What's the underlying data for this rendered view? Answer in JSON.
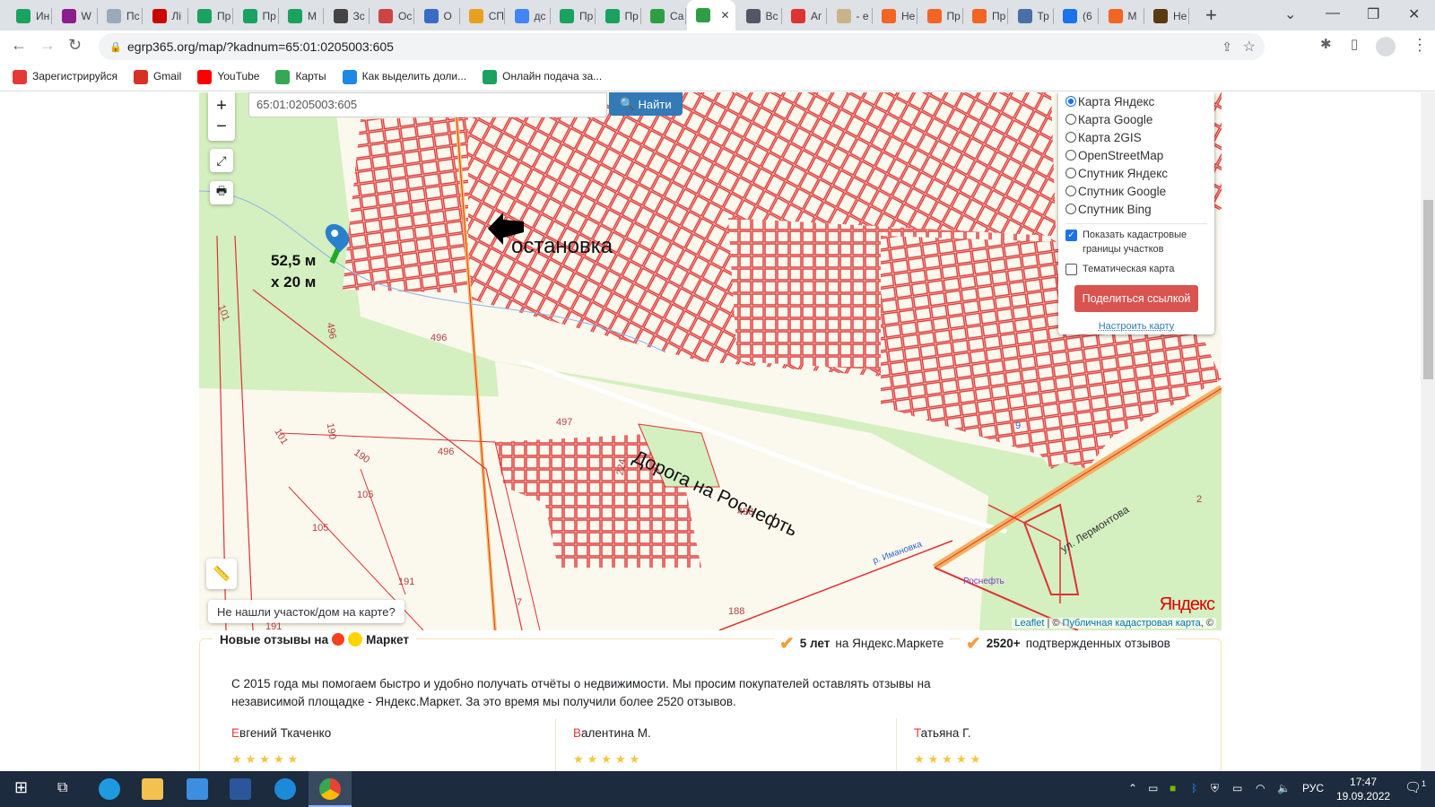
{
  "browser": {
    "tabs": [
      {
        "label": "Ин",
        "color": "#1aa260"
      },
      {
        "label": "W",
        "color": "#8b1e8b"
      },
      {
        "label": "Пс",
        "color": "#9ab"
      },
      {
        "label": "Лі",
        "color": "#c00"
      },
      {
        "label": "Пр",
        "color": "#1aa260"
      },
      {
        "label": "Пр",
        "color": "#1aa260"
      },
      {
        "label": "М",
        "color": "#1aa260"
      },
      {
        "label": "Зс",
        "color": "#444"
      },
      {
        "label": "Ос",
        "color": "#c44"
      },
      {
        "label": "О",
        "color": "#3b6cc4"
      },
      {
        "label": "СП",
        "color": "#e8a020"
      },
      {
        "label": "дс",
        "color": "#4285f4"
      },
      {
        "label": "Пр",
        "color": "#1aa260"
      },
      {
        "label": "Пр",
        "color": "#1aa260"
      },
      {
        "label": "Са",
        "color": "#2e9e44"
      },
      {
        "label": "",
        "color": "#2e9e44",
        "active": true
      },
      {
        "label": "Вс",
        "color": "#556"
      },
      {
        "label": "Аг",
        "color": "#d33"
      },
      {
        "label": "- е",
        "color": "#c9b38a"
      },
      {
        "label": "Не",
        "color": "#f26522"
      },
      {
        "label": "Пр",
        "color": "#f26522"
      },
      {
        "label": "Пр",
        "color": "#f26522"
      },
      {
        "label": "Тр",
        "color": "#4a6fa5"
      },
      {
        "label": "(6",
        "color": "#1a73e8"
      },
      {
        "label": "М",
        "color": "#f26522"
      },
      {
        "label": "Не",
        "color": "#5a3a10"
      }
    ],
    "url": "egrp365.org/map/?kadnum=65:01:0205003:605",
    "bookmarks": [
      {
        "label": "Зарегистрируйся",
        "color": "#e53935"
      },
      {
        "label": "Gmail",
        "color": "#d93025"
      },
      {
        "label": "YouTube",
        "color": "#ff0000"
      },
      {
        "label": "Карты",
        "color": "#34a853"
      },
      {
        "label": "Как выделить доли...",
        "color": "#1e88e5"
      },
      {
        "label": "Онлайн подача за...",
        "color": "#1aa260"
      }
    ]
  },
  "map": {
    "search_value": "65:01:0205003:605",
    "find_label": "Найти",
    "layers": [
      "Карта Яндекс",
      "Карта Google",
      "Карта 2GIS",
      "OpenStreetMap",
      "Спутник Яндекс",
      "Спутник Google",
      "Спутник Bing"
    ],
    "selected_layer": "Карта Яндекс",
    "show_cadastral": {
      "label": "Показать кадастровые границы участков",
      "checked": true
    },
    "thematic": {
      "label": "Тематическая карта",
      "checked": false
    },
    "share_label": "Поделиться ссылкой",
    "configure_label": "Настроить карту",
    "not_found_label": "Не нашли участок/дом на карте?",
    "annotations": {
      "size_line1": "52,5 м",
      "size_line2": "х 20 м",
      "stop": "остановка",
      "road": "Дорога на Роснефть"
    },
    "labels": {
      "l496a": "496",
      "l496b": "496",
      "l496c": "496",
      "l497": "497",
      "l498": "498",
      "l101a": "101",
      "l101b": "101",
      "l190a": "190",
      "l190b": "190",
      "l105a": "105",
      "l105b": "105",
      "l191a": "191",
      "l191b": "191",
      "l188": "188",
      "l7": "7",
      "l2": "2",
      "l9": "9",
      "l224": "224",
      "street": "ул. Лермонтова",
      "river": "р. Имановка",
      "rosneft": "Роснефть",
      "yandex": "Яндекс"
    },
    "attribution": {
      "leaflet": "Leaflet",
      "sep": " | © ",
      "pkk": "Публичная кадастровая карта",
      "tail": ", ©"
    }
  },
  "reviews": {
    "title_pre": "Новые отзывы на",
    "title_post": "Маркет",
    "badge1_bold": "5 лет",
    "badge1_rest": "на Яндекс.Маркете",
    "badge2_bold": "2520+",
    "badge2_rest": "подтвержденных отзывов",
    "intro": "С 2015 года мы помогаем быстро и удобно получать отчёты о недвижимости. Мы просим покупателей оставлять отзывы на независимой площадке - Яндекс.Маркет. За это время мы получили более 2520 отзывов.",
    "people": [
      {
        "first": "Е",
        "rest": "вгений Ткаченко",
        "rating": 5
      },
      {
        "first": "В",
        "rest": "алентина М.",
        "rating": 5
      },
      {
        "first": "Т",
        "rest": "атьяна Г.",
        "rating": 5
      }
    ]
  },
  "taskbar": {
    "lang": "РУС",
    "time": "17:47",
    "date": "19.09.2022",
    "notifications": "1"
  }
}
